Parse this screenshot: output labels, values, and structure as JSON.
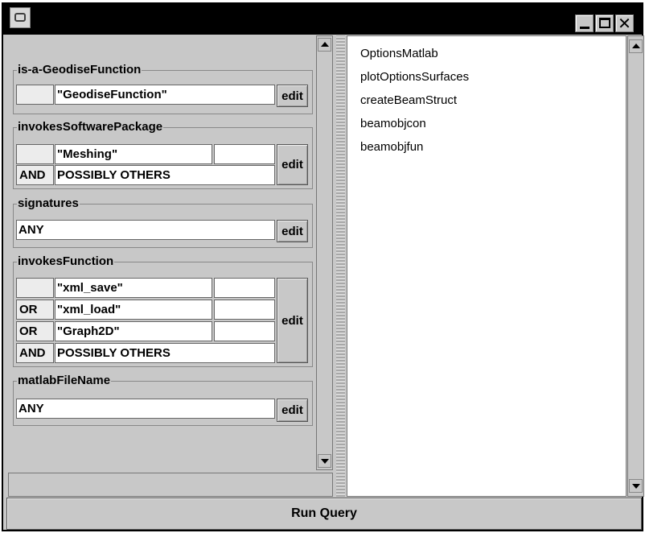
{
  "window": {
    "close_glyph": "✕"
  },
  "groups": {
    "geodise": {
      "title": "is-a-GeodiseFunction",
      "value": "\"GeodiseFunction\"",
      "edit": "edit"
    },
    "software": {
      "title": "invokesSoftwarePackage",
      "row1_value": "\"Meshing\"",
      "row2_op": "AND",
      "row2_value": "POSSIBLY OTHERS",
      "edit": "edit"
    },
    "signatures": {
      "title": "signatures",
      "value": "ANY",
      "edit": "edit"
    },
    "functions": {
      "title": "invokesFunction",
      "rows": [
        {
          "op": "",
          "value": "\"xml_save\""
        },
        {
          "op": "OR",
          "value": "\"xml_load\""
        },
        {
          "op": "OR",
          "value": "\"Graph2D\""
        },
        {
          "op": "AND",
          "value": "POSSIBLY OTHERS"
        }
      ],
      "edit": "edit"
    },
    "filename": {
      "title": "matlabFileName",
      "value": "ANY",
      "edit": "edit"
    }
  },
  "results": [
    "OptionsMatlab",
    "plotOptionsSurfaces",
    "createBeamStruct",
    "beamobjcon",
    "beamobjfun"
  ],
  "run_button": "Run Query"
}
